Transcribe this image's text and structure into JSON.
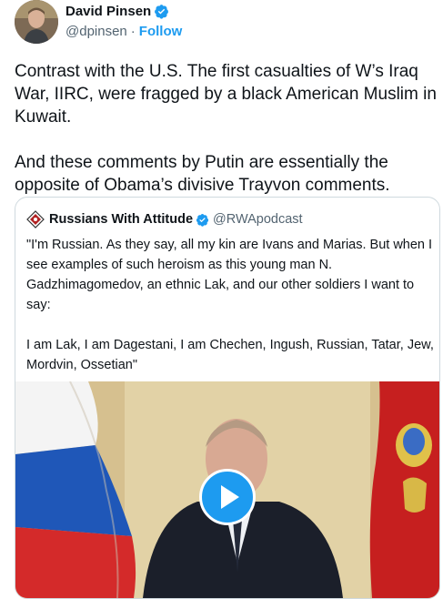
{
  "tweet": {
    "author_name": "David Pinsen",
    "author_handle": "@dpinsen",
    "separator": "·",
    "follow_label": "Follow",
    "paragraphs": [
      "Contrast with the U.S. The first casualties of W’s Iraq War, IIRC, were fragged by a black American Muslim in Kuwait.",
      "And these comments by Putin are essentially the opposite of Obama’s divisive Trayvon comments."
    ]
  },
  "quoted": {
    "author_name": "Russians With Attitude",
    "author_handle": "@RWApodcast",
    "paragraphs": [
      "\"I'm Russian. As they say, all my kin are Ivans and Marias. But when I see examples of such heroism as this young man N. Gadzhimagomedov, an ethnic Lak, and our other soldiers I want to say:",
      "I am Lak, I am Dagestani, I am Chechen, Ingush, Russian, Tatar, Jew, Mordvin, Ossetian\""
    ]
  },
  "icons": {
    "verified": "verified-badge-icon",
    "play": "play-icon"
  },
  "colors": {
    "accent": "#1d9bf0",
    "text": "#0f1419",
    "secondary": "#536471",
    "border": "#cfd9de"
  }
}
